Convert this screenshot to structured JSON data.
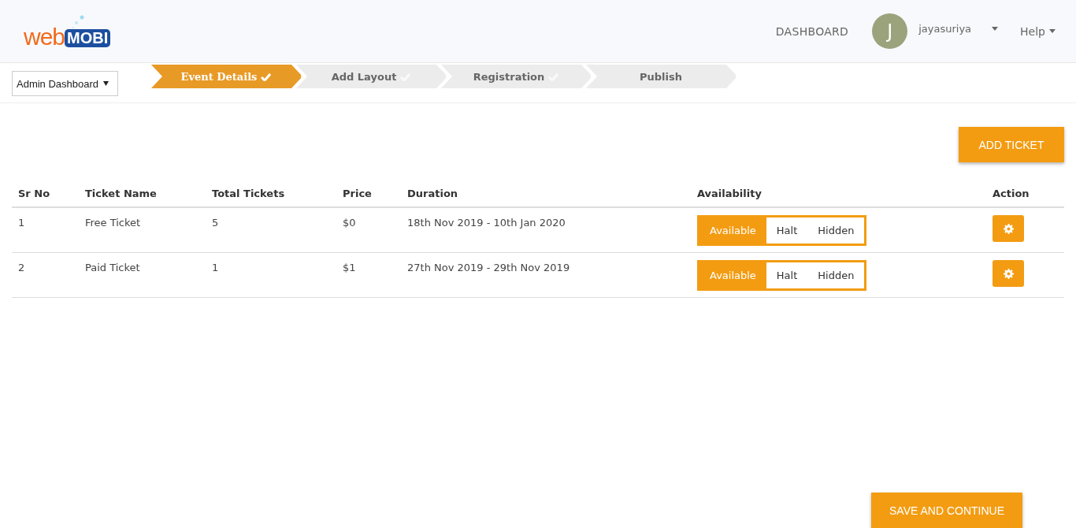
{
  "logo": {
    "part_1": "web",
    "part_2": "MOBI"
  },
  "nav": {
    "dashboard": "DASHBOARD",
    "avatar_letter": "J",
    "user": "jayasuriya",
    "help": "Help"
  },
  "dashboard_select": {
    "value": "Admin Dashboard"
  },
  "steps": [
    {
      "label": "Event Details",
      "selected": true,
      "checked": true
    },
    {
      "label": "Add Layout",
      "selected": false,
      "checked": true
    },
    {
      "label": "Registration",
      "selected": false,
      "checked": true
    },
    {
      "label": "Publish",
      "selected": false,
      "checked": false
    }
  ],
  "add_button": "ADD TICKET",
  "table": {
    "columns": [
      "Sr No",
      "Ticket Name",
      "Total Tickets",
      "Price",
      "Duration",
      "Availability",
      "Action"
    ],
    "rows": [
      {
        "sr": "1",
        "name": "Free Ticket",
        "total": "5",
        "price": "$0",
        "duration": "18th Nov 2019 - 10th Jan 2020",
        "availability": [
          {
            "label": "Available",
            "selected": true
          },
          {
            "label": "Halt",
            "selected": false
          },
          {
            "label": "Hidden",
            "selected": false
          }
        ]
      },
      {
        "sr": "2",
        "name": "Paid Ticket",
        "total": "1",
        "price": "$1",
        "duration": "27th Nov 2019 - 29th Nov 2019",
        "availability": [
          {
            "label": "Available",
            "selected": true
          },
          {
            "label": "Halt",
            "selected": false
          },
          {
            "label": "Hidden",
            "selected": false
          }
        ]
      }
    ]
  },
  "save_button": "SAVE AND CONTINUE"
}
